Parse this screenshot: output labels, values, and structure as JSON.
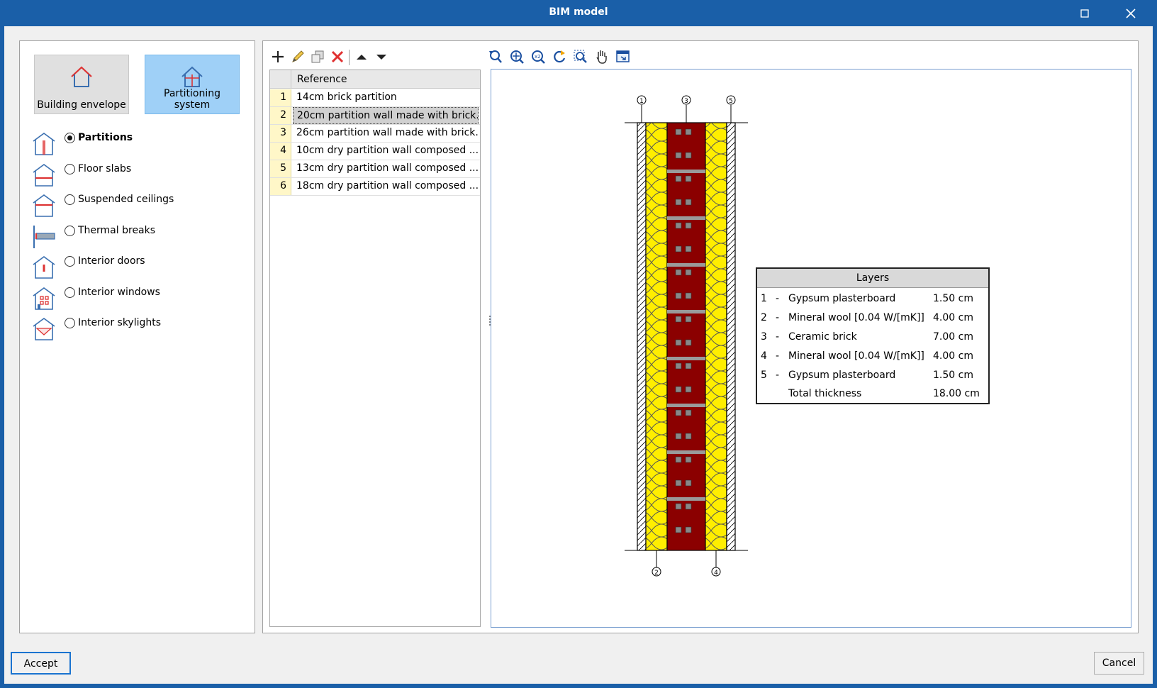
{
  "window": {
    "title": "BIM model"
  },
  "left": {
    "btn_envelope": "Building envelope",
    "btn_partitioning": "Partitioning system",
    "options": [
      {
        "label": "Partitions",
        "selected": true,
        "icon": "partition-icon"
      },
      {
        "label": "Floor slabs",
        "selected": false,
        "icon": "floor-slab-icon"
      },
      {
        "label": "Suspended ceilings",
        "selected": false,
        "icon": "suspended-ceiling-icon"
      },
      {
        "label": "Thermal breaks",
        "selected": false,
        "icon": "thermal-break-icon"
      },
      {
        "label": "Interior doors",
        "selected": false,
        "icon": "interior-door-icon"
      },
      {
        "label": "Interior windows",
        "selected": false,
        "icon": "interior-window-icon"
      },
      {
        "label": "Interior skylights",
        "selected": false,
        "icon": "interior-skylight-icon"
      }
    ]
  },
  "list": {
    "header": "Reference",
    "rows": [
      {
        "num": "1",
        "ref": "14cm brick partition"
      },
      {
        "num": "2",
        "ref": "20cm partition wall made with brick..."
      },
      {
        "num": "3",
        "ref": "26cm partition wall made with brick..."
      },
      {
        "num": "4",
        "ref": "10cm dry partition wall composed ..."
      },
      {
        "num": "5",
        "ref": "13cm dry partition wall composed ..."
      },
      {
        "num": "6",
        "ref": "18cm dry partition wall composed ..."
      }
    ],
    "selected_index": 1
  },
  "drawing": {
    "axis_labels": [
      "1",
      "3",
      "5",
      "2",
      "4"
    ]
  },
  "legend": {
    "title": "Layers",
    "rows": [
      {
        "n": "1",
        "d": "-",
        "name": "Gypsum plasterboard",
        "value": "1.50 cm"
      },
      {
        "n": "2",
        "d": "-",
        "name": "Mineral wool [0.04 W/[mK]]",
        "value": "4.00 cm"
      },
      {
        "n": "3",
        "d": "-",
        "name": "Ceramic brick",
        "value": "7.00 cm"
      },
      {
        "n": "4",
        "d": "-",
        "name": "Mineral wool [0.04 W/[mK]]",
        "value": "4.00 cm"
      },
      {
        "n": "5",
        "d": "-",
        "name": "Gypsum plasterboard",
        "value": "1.50 cm"
      },
      {
        "n": "",
        "d": "",
        "name": "Total thickness",
        "value": "18.00 cm"
      }
    ]
  },
  "footer": {
    "accept": "Accept",
    "cancel": "Cancel"
  },
  "colors": {
    "titlebar": "#1a5fa8",
    "active_tab": "#9fd0f7",
    "brick": "#8b0000",
    "wool": "#ffee00"
  }
}
